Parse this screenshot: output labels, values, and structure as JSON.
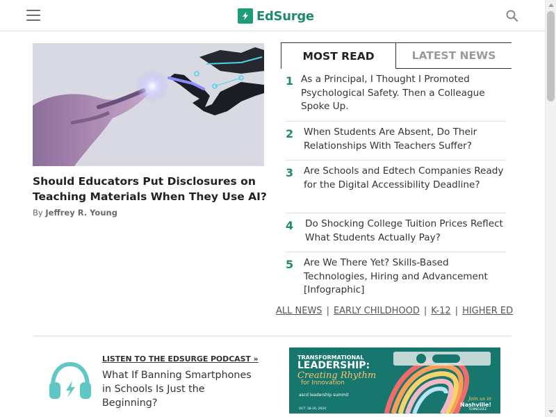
{
  "header": {
    "brand": "EdSurge",
    "brand_color": "#1f8a70",
    "menu_icon": "hamburger-icon",
    "search_icon": "search-icon"
  },
  "feature": {
    "title": "Should Educators Put Disclosures on Teaching Materials When They Use AI?",
    "byline_prefix": "By",
    "author": "Jeffrey R. Young"
  },
  "tabs": [
    {
      "label": "MOST READ",
      "active": true
    },
    {
      "label": "LATEST NEWS",
      "active": false
    }
  ],
  "most_read": [
    {
      "num": "1",
      "title": "As a Principal, I Thought I Promoted Psychological Safety. Then a Colleague Spoke Up."
    },
    {
      "num": "2",
      "title": "When Students Are Absent, Do Their Relationships With Teachers Suffer?"
    },
    {
      "num": "3",
      "title": "Are Schools and Edtech Companies Ready for the Digital Accessibility Deadline?"
    },
    {
      "num": "4",
      "title": "Do Shocking College Tuition Prices Reflect What Students Actually Pay?"
    },
    {
      "num": "5",
      "title": "Are We There Yet? Skills-Based Technologies, Hiring and Advancement [Infographic]"
    }
  ],
  "sections": {
    "links": [
      "ALL NEWS",
      "EARLY CHILDHOOD",
      "K-12",
      "HIGHER ED"
    ],
    "separator": "|"
  },
  "podcast": {
    "label": "LISTEN TO THE EDSURGE PODCAST »",
    "title": "What If Banning Smartphones in Schools Is Just the Beginning?",
    "icon": "headphones-icon"
  },
  "ad": {
    "line1": "TRANSFORMATIONAL",
    "line2": "LEADERSHIP:",
    "line3": "Creating Rhythm",
    "line4": "for Innovation",
    "summit": "ascd leadership summit",
    "date": "OCT. 18-20, 2024",
    "join": "Join us in",
    "city": "Nashville!",
    "state": "TENNESSEE",
    "bg_color": "#17766d"
  }
}
